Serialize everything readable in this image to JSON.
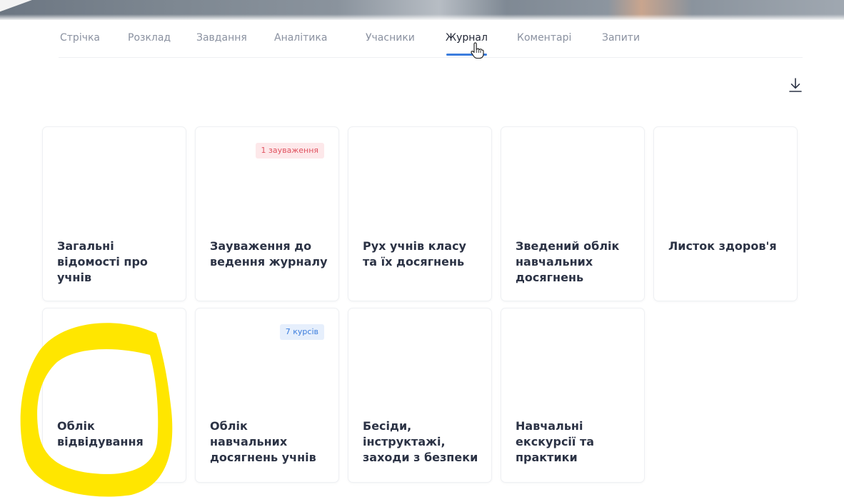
{
  "tabs": [
    {
      "label": "Стрічка"
    },
    {
      "label": "Розклад"
    },
    {
      "label": "Завдання"
    },
    {
      "label": "Аналітика"
    },
    {
      "label": "Учасники"
    },
    {
      "label": "Журнал"
    },
    {
      "label": "Коментарі"
    },
    {
      "label": "Запити"
    }
  ],
  "active_tab": "Журнал",
  "toolbar": {
    "download_icon": "download-icon"
  },
  "cards": [
    {
      "title": "Загальні відомості про учнів",
      "badge": ""
    },
    {
      "title": "Зауваження до ведення журналу",
      "badge": "1 зауваження"
    },
    {
      "title": "Рух учнів класу та їх досягнень",
      "badge": ""
    },
    {
      "title": "Зведений облік навчальних досягнень",
      "badge": ""
    },
    {
      "title": "Листок здоров'я",
      "badge": ""
    },
    {
      "title": "Облік відвідування",
      "badge": ""
    },
    {
      "title": "Облік навчальних досягнень учнів",
      "badge": "7 курсів"
    },
    {
      "title": "Бесіди, інструктажі, заходи з безпеки",
      "badge": ""
    },
    {
      "title": "Навчальні екскурсії та практики",
      "badge": ""
    }
  ],
  "colors": {
    "accent": "#3b7ddd",
    "badge_red_bg": "#fde8ea",
    "badge_red_text": "#e0525f",
    "badge_blue_bg": "#e6effc",
    "badge_blue_text": "#3b7ddd",
    "highlight": "#ffe600"
  }
}
